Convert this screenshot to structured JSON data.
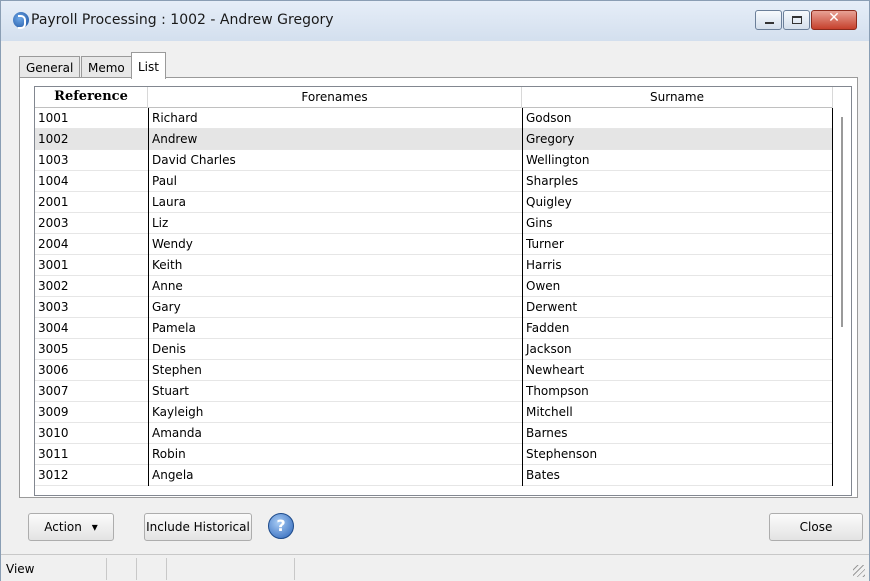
{
  "window": {
    "title": "Payroll Processing : 1002 - Andrew Gregory",
    "close_glyph": "✕"
  },
  "tabs": [
    {
      "label": "General",
      "active": false
    },
    {
      "label": "Memo",
      "active": false
    },
    {
      "label": "List",
      "active": true
    }
  ],
  "table": {
    "columns": [
      "Reference",
      "Forenames",
      "Surname"
    ],
    "selected_reference": "1002",
    "rows": [
      {
        "ref": "1001",
        "forenames": "Richard",
        "surname": "Godson"
      },
      {
        "ref": "1002",
        "forenames": "Andrew",
        "surname": "Gregory"
      },
      {
        "ref": "1003",
        "forenames": "David Charles",
        "surname": "Wellington"
      },
      {
        "ref": "1004",
        "forenames": "Paul",
        "surname": "Sharples"
      },
      {
        "ref": "2001",
        "forenames": "Laura",
        "surname": "Quigley"
      },
      {
        "ref": "2003",
        "forenames": "Liz",
        "surname": "Gins"
      },
      {
        "ref": "2004",
        "forenames": "Wendy",
        "surname": "Turner"
      },
      {
        "ref": "3001",
        "forenames": "Keith",
        "surname": "Harris"
      },
      {
        "ref": "3002",
        "forenames": "Anne",
        "surname": "Owen"
      },
      {
        "ref": "3003",
        "forenames": "Gary",
        "surname": "Derwent"
      },
      {
        "ref": "3004",
        "forenames": "Pamela",
        "surname": "Fadden"
      },
      {
        "ref": "3005",
        "forenames": "Denis",
        "surname": "Jackson"
      },
      {
        "ref": "3006",
        "forenames": "Stephen",
        "surname": "Newheart"
      },
      {
        "ref": "3007",
        "forenames": "Stuart",
        "surname": "Thompson"
      },
      {
        "ref": "3009",
        "forenames": "Kayleigh",
        "surname": "Mitchell"
      },
      {
        "ref": "3010",
        "forenames": "Amanda",
        "surname": "Barnes"
      },
      {
        "ref": "3011",
        "forenames": "Robin",
        "surname": "Stephenson"
      },
      {
        "ref": "3012",
        "forenames": "Angela",
        "surname": "Bates"
      }
    ]
  },
  "buttons": {
    "action_label": "Action",
    "action_arrow": "▾",
    "include_historical_label": "Include Historical",
    "help_glyph": "?",
    "close_label": "Close"
  },
  "status": {
    "mode": "View"
  },
  "icons": {
    "app": "app-logo-icon",
    "help": "help-icon",
    "minimize": "minimize-icon",
    "maximize": "maximize-icon",
    "close": "close-icon",
    "dropdown": "chevron-down-icon",
    "resize": "resize-grip-icon"
  },
  "colors": {
    "selected_row": "#e5e5e5",
    "close_button": "#c6402c",
    "titlebar": "#d3dfee"
  }
}
